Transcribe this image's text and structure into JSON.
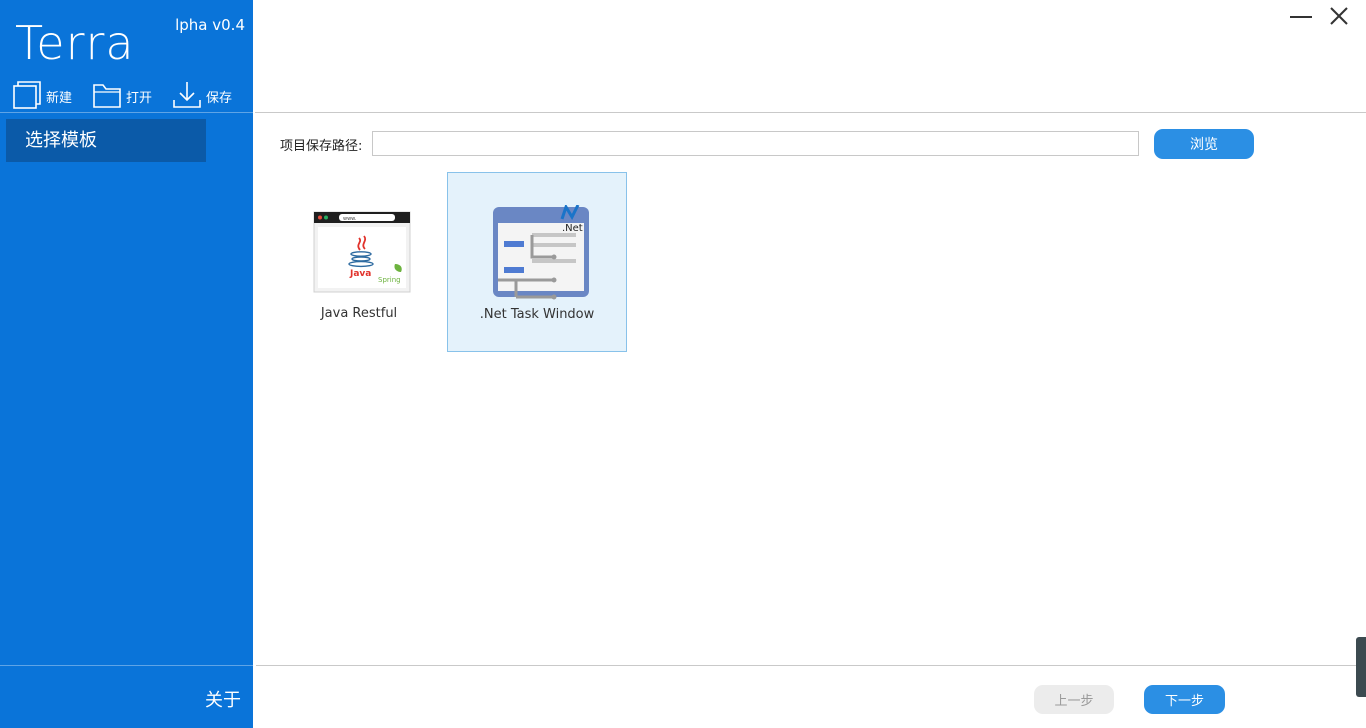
{
  "sidebar": {
    "title": "Terra",
    "version": "lpha v0.4",
    "toolbar": {
      "new_label": "新建",
      "open_label": "打开",
      "save_label": "保存"
    },
    "nav_items": [
      {
        "label": "选择模板",
        "active": true
      }
    ],
    "about_label": "关于"
  },
  "main": {
    "path_label": "项目保存路径:",
    "path_value": "",
    "browse_label": "浏览",
    "templates": [
      {
        "name": "Java Restful",
        "icon": "java-spring-icon",
        "selected": false
      },
      {
        "name": ".Net Task Window",
        "icon": "dotnet-window-icon",
        "selected": true
      }
    ],
    "java_thumb": {
      "url_text": "www.",
      "java_text": "Java",
      "spring_text": "Spring"
    },
    "net_thumb": {
      "badge_text": ".Net"
    },
    "prev_label": "上一步",
    "next_label": "下一步"
  },
  "colors": {
    "sidebar_bg": "#0a74d9",
    "nav_active_bg": "#0b5aa8",
    "accent_button": "#2b8fe4",
    "selected_tile_bg": "#e4f2fb",
    "selected_tile_border": "#88c2ea"
  }
}
